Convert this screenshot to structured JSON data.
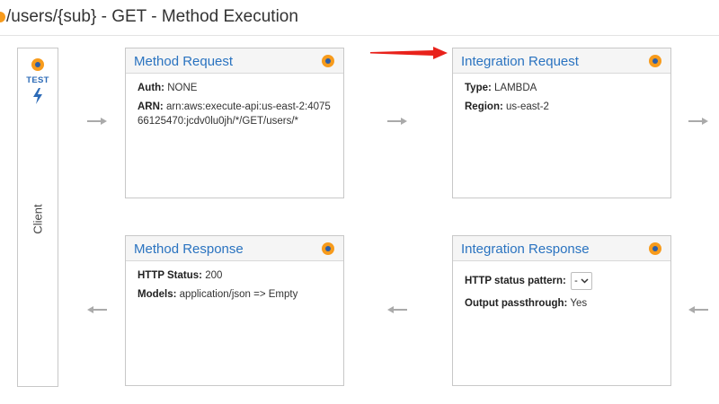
{
  "header": {
    "title": "/users/{sub} - GET - Method Execution"
  },
  "client": {
    "test_label": "TEST",
    "label": "Client",
    "bolt_icon": "lightning-icon"
  },
  "method_request": {
    "title": "Method Request",
    "auth_label": "Auth:",
    "auth_value": "NONE",
    "arn_label": "ARN:",
    "arn_value": "arn:aws:execute-api:us-east-2:407566125470:jcdv0lu0jh/*/GET/users/*"
  },
  "integration_request": {
    "title": "Integration Request",
    "type_label": "Type:",
    "type_value": "LAMBDA",
    "region_label": "Region:",
    "region_value": "us-east-2"
  },
  "method_response": {
    "title": "Method Response",
    "status_label": "HTTP Status:",
    "status_value": "200",
    "models_label": "Models:",
    "models_value": "application/json => Empty"
  },
  "integration_response": {
    "title": "Integration Response",
    "pattern_label": "HTTP status pattern:",
    "pattern_value": "-",
    "passthrough_label": "Output passthrough:",
    "passthrough_value": "Yes"
  },
  "colors": {
    "accent": "#2a73c0",
    "orange": "#f79b1c",
    "arrow_gray": "#aaaaaa",
    "annotation_red": "#e8221b"
  }
}
